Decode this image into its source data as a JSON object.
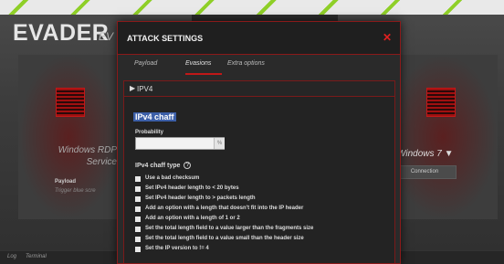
{
  "app": {
    "logo": "EVADER",
    "logo_suffix": "EV",
    "target_left_line1": "Windows RDP",
    "target_left_line2": "Service",
    "target_right": "Windows 7 ▼",
    "payload_label": "Payload",
    "payload_value": "Trigger blue scre",
    "connection_button": "Connection",
    "bottom_tabs": [
      "Log",
      "Terminal"
    ]
  },
  "modal": {
    "title": "ATTACK SETTINGS",
    "close_icon": "close-icon",
    "tabs": [
      {
        "label": "Payload"
      },
      {
        "label": "Evasions",
        "active": true
      },
      {
        "label": "Extra options"
      }
    ],
    "section": "IPV4",
    "chaff_title": "IPv4 chaff",
    "probability_label": "Probability",
    "probability_value": "",
    "probability_unit": "%",
    "chaff_type_label": "IPv4 chaff type",
    "options": [
      "Use a bad checksum",
      "Set IPv4 header length to < 20 bytes",
      "Set IPv4 header length to > packets length",
      "Add an option with a length that doesn't fit into the IP header",
      "Add an option with a length of 1 or 2",
      "Set the total length field to a value larger than the fragments size",
      "Set the total length field to a value small than the header size",
      "Set the IP version to != 4"
    ]
  },
  "colors": {
    "accent": "#c01818",
    "highlight": "#3c5fa8",
    "stripe_green": "#8fcf28"
  }
}
